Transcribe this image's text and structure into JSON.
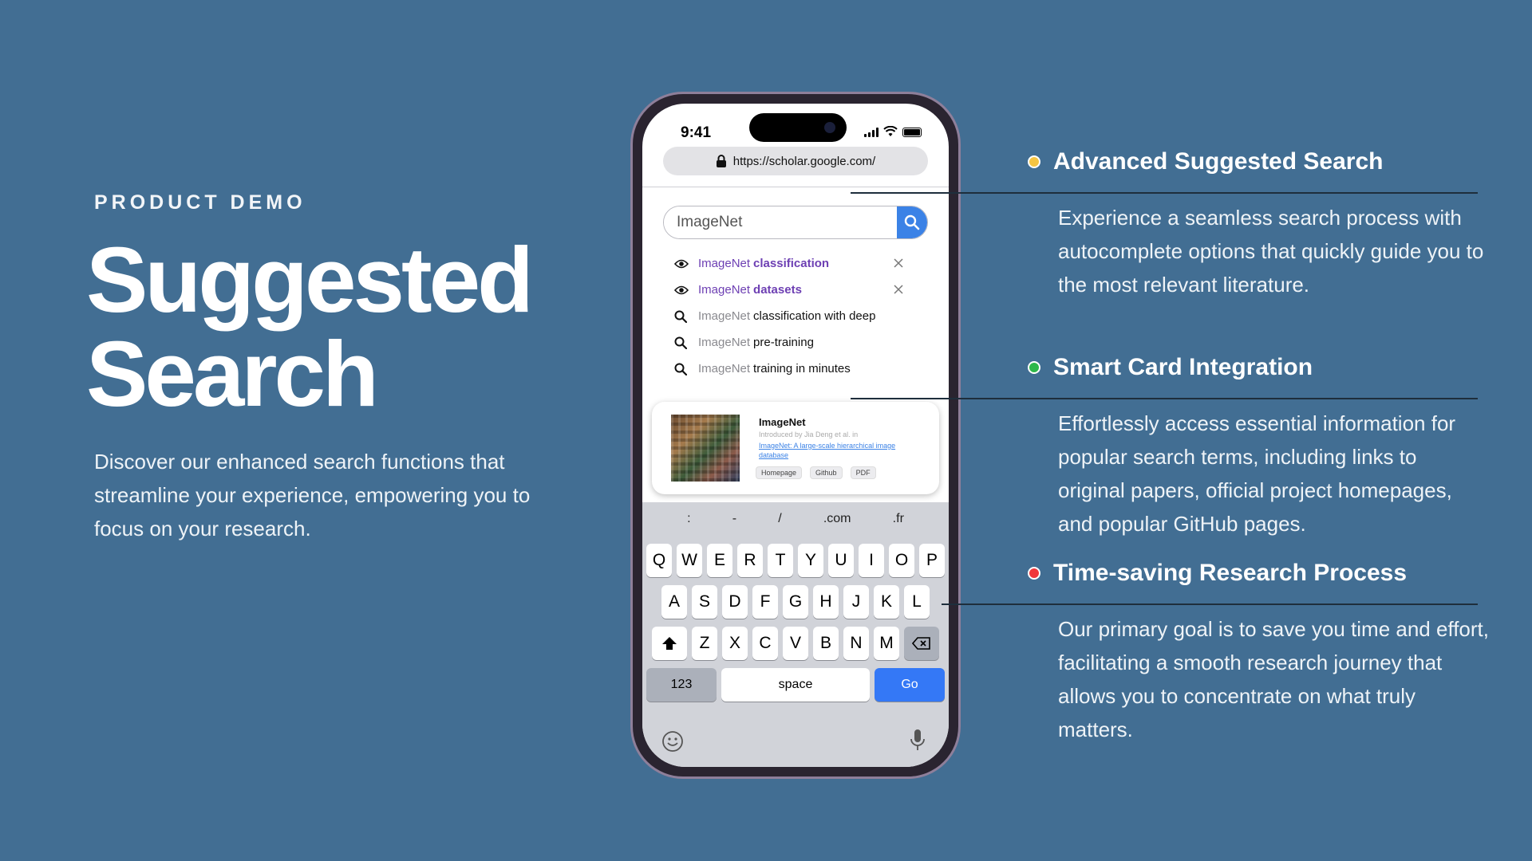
{
  "eyebrow": "PRODUCT DEMO",
  "hero": {
    "title_line1": "Suggested",
    "title_line2": "Search",
    "description": "Discover our enhanced search functions that streamline your experience, empowering you to focus on your research."
  },
  "phone": {
    "status_time": "9:41",
    "url": "https://scholar.google.com/",
    "search_value": "ImageNet",
    "suggestions": [
      {
        "type": "history",
        "prefix": "ImageNet",
        "rest": "classification"
      },
      {
        "type": "history",
        "prefix": "ImageNet",
        "rest": "datasets"
      },
      {
        "type": "search",
        "prefix": "ImageNet",
        "rest": "classification with deep"
      },
      {
        "type": "search",
        "prefix": "ImageNet",
        "rest": "pre-training"
      },
      {
        "type": "search",
        "prefix": "ImageNet",
        "rest": "training in minutes"
      }
    ],
    "smart_card": {
      "title": "ImageNet",
      "subtitle": "Introduced by Jia Deng et al. in",
      "link": "ImageNet: A large-scale hierarchical image database",
      "tags": [
        "Homepage",
        "Github",
        "PDF"
      ]
    },
    "keyboard": {
      "accessory": [
        ":",
        "-",
        "/",
        ".com",
        ".fr"
      ],
      "row1": [
        "Q",
        "W",
        "E",
        "R",
        "T",
        "Y",
        "U",
        "I",
        "O",
        "P"
      ],
      "row2": [
        "A",
        "S",
        "D",
        "F",
        "G",
        "H",
        "J",
        "K",
        "L"
      ],
      "row3": [
        "Z",
        "X",
        "C",
        "V",
        "B",
        "N",
        "M"
      ],
      "num_label": "123",
      "space_label": "space",
      "go_label": "Go"
    }
  },
  "features": [
    {
      "title": "Advanced Suggested Search",
      "color": "#f5c542",
      "description": "Experience a seamless search process with autocomplete options that quickly guide you to the most relevant literature."
    },
    {
      "title": "Smart Card Integration",
      "color": "#2db84a",
      "description": "Effortlessly access essential information for popular search terms, including links to original papers, official project homepages, and popular GitHub pages."
    },
    {
      "title": "Time-saving Research Process",
      "color": "#f0363a",
      "description": "Our primary goal is to save you time and effort, facilitating a smooth research journey that allows you to concentrate on what truly matters."
    }
  ]
}
